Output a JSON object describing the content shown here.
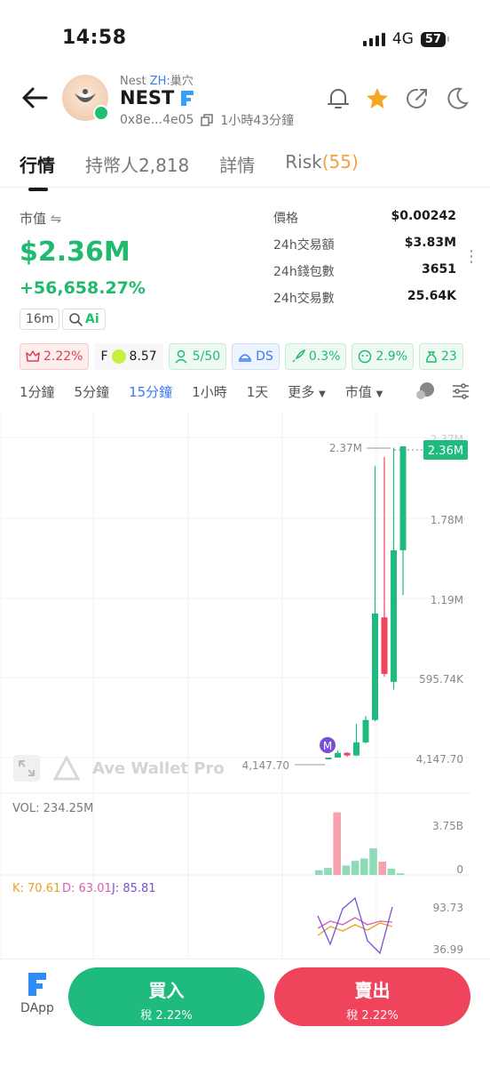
{
  "status": {
    "time": "14:58",
    "network": "4G",
    "battery": "57"
  },
  "token": {
    "sub_name": "Nest",
    "sub_zh_tag": "ZH:",
    "sub_zh_name": "巢穴",
    "name": "NEST",
    "address": "0x8e...4e05",
    "age": "1小時43分鐘"
  },
  "tabs": [
    {
      "label": "行情"
    },
    {
      "label": "持幣人2,818"
    },
    {
      "label": "詳情"
    },
    {
      "label": "Risk",
      "count": "(55)"
    }
  ],
  "market": {
    "mcap_label": "市值",
    "mcap_value": "$2.36M",
    "change": "+56,658.27%",
    "age_chip": "16m",
    "ai_label": "Ai"
  },
  "stats": [
    {
      "k": "價格",
      "v": "$0.00242"
    },
    {
      "k": "24h交易額",
      "v": "$3.83M"
    },
    {
      "k": "24h錢包數",
      "v": "3651"
    },
    {
      "k": "24h交易數",
      "v": "25.64K"
    }
  ],
  "badges": {
    "tax": "2.22%",
    "f_label": "F",
    "f_value": "8.57",
    "holders": "5/50",
    "ds": "DS",
    "rocket": "0.3%",
    "face": "2.9%",
    "bag": "23"
  },
  "intervals": [
    "1分鐘",
    "5分鐘",
    "15分鐘",
    "1小時",
    "1天",
    "更多",
    "市值"
  ],
  "chart": {
    "price_labels": [
      "2.37M",
      "1.78M",
      "1.19M",
      "595.74K",
      "4,147.70"
    ],
    "current_price": "2.36M",
    "high_label": "2.37M",
    "low_label": "4,147.70",
    "marker": "M",
    "watermark": "Ave Wallet Pro",
    "vol_label": "VOL: 234.25M",
    "vol_ticks": [
      "3.75B",
      "0"
    ],
    "kdj_k": "K: 70.61",
    "kdj_d": "D: 63.01",
    "kdj_j": "J: 85.81",
    "kdj_ticks": [
      "93.73",
      "36.99"
    ],
    "candles": [
      {
        "o": 4147.7,
        "c": 4147.7,
        "h": 4147.7,
        "l": 4147.7
      },
      {
        "o": 4147.7,
        "c": 40000,
        "h": 60000,
        "l": 4147.7
      },
      {
        "o": 40000,
        "c": 20000,
        "h": 45000,
        "l": 10000
      },
      {
        "o": 20000,
        "c": 120000,
        "h": 260000,
        "l": 15000
      },
      {
        "o": 120000,
        "c": 290000,
        "h": 320000,
        "l": 110000
      },
      {
        "o": 290000,
        "c": 1100000,
        "h": 2220000,
        "l": 280000
      },
      {
        "o": 1070000,
        "c": 640000,
        "h": 2290000,
        "l": 620000
      },
      {
        "o": 580000,
        "c": 1580000,
        "h": 2360000,
        "l": 520000
      },
      {
        "o": 1580000,
        "c": 2370000,
        "h": 2370000,
        "l": 1240000
      }
    ],
    "volumes": [
      0.3,
      0.45,
      4.0,
      0.6,
      0.9,
      1.05,
      1.7,
      0.85,
      0.4,
      0.1
    ],
    "volume_colors": [
      "g",
      "g",
      "r",
      "g",
      "g",
      "g",
      "g",
      "r",
      "g",
      "g"
    ]
  },
  "bottom": {
    "dapp": "DApp",
    "buy": "買入",
    "buy_tax": "稅 2.22%",
    "sell": "賣出",
    "sell_tax": "稅 2.22%"
  },
  "colors": {
    "up": "#1fba7e",
    "down": "#f0445d",
    "accent": "#3a7bf5"
  }
}
